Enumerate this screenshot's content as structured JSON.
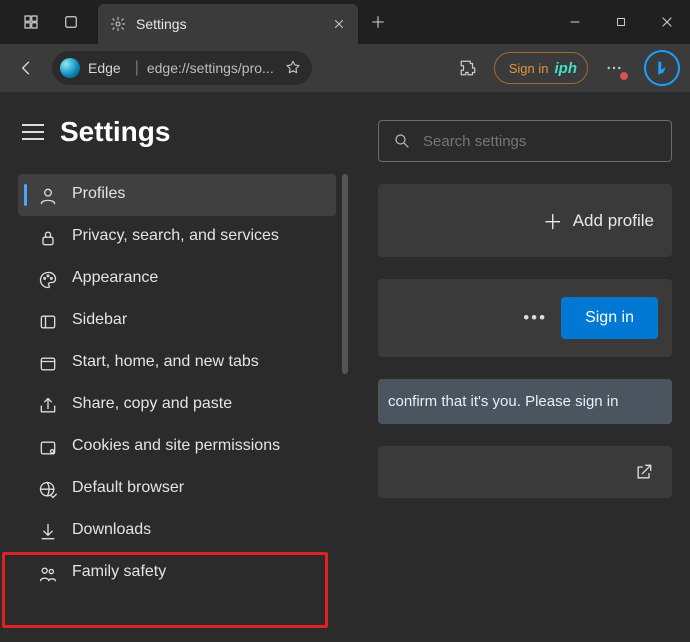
{
  "titlebar": {
    "tab_title": "Settings"
  },
  "toolbar": {
    "browser_label": "Edge",
    "url_text": "edge://settings/pro...",
    "signin_label": "Sign in",
    "signin_brand": "iph"
  },
  "sidebar": {
    "heading": "Settings",
    "items": [
      {
        "label": "Profiles"
      },
      {
        "label": "Privacy, search, and services"
      },
      {
        "label": "Appearance"
      },
      {
        "label": "Sidebar"
      },
      {
        "label": "Start, home, and new tabs"
      },
      {
        "label": "Share, copy and paste"
      },
      {
        "label": "Cookies and site permissions"
      },
      {
        "label": "Default browser"
      },
      {
        "label": "Downloads"
      },
      {
        "label": "Family safety"
      }
    ]
  },
  "content": {
    "search_placeholder": "Search settings",
    "add_profile_label": "Add profile",
    "signin_button": "Sign in",
    "more_menu": "•••",
    "confirm_text": "confirm that it's you. Please sign in"
  }
}
